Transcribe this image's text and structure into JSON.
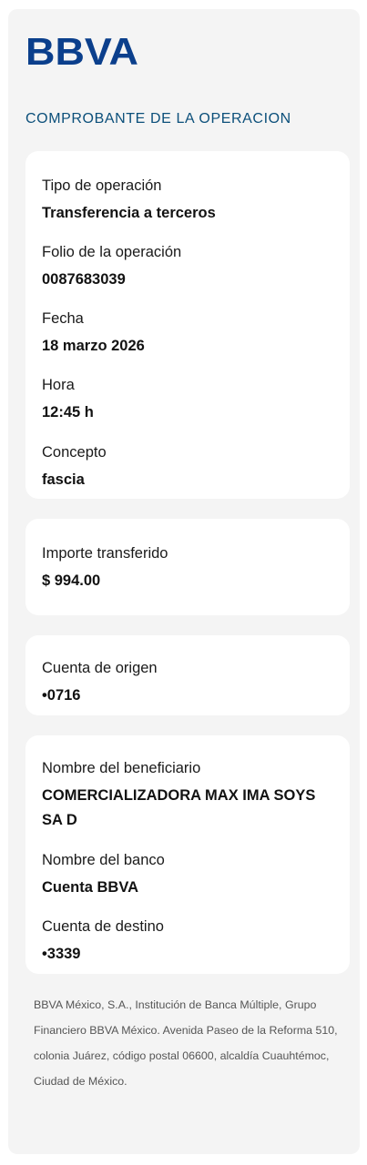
{
  "brand": {
    "logo_text": "BBVA",
    "color": "#0b3f8c"
  },
  "heading": "COMPROBANTE DE LA OPERACION",
  "colors": {
    "heading": "#0b4f7a",
    "card_background": "#ffffff",
    "page_background": "#f4f4f4"
  },
  "operation_card": {
    "tipo_label": "Tipo de operación",
    "tipo_value": "Transferencia a terceros",
    "folio_label": "Folio de la operación",
    "folio_value": "0087683039",
    "fecha_label": "Fecha",
    "fecha_value": "18 marzo 2026",
    "hora_label": "Hora",
    "hora_value": "12:45 h",
    "concepto_label": "Concepto",
    "concepto_value": "fascia"
  },
  "amount_card": {
    "label": "Importe transferido",
    "value": "$ 994.00"
  },
  "origin_card": {
    "label": "Cuenta de origen",
    "value": "•0716"
  },
  "beneficiary_card": {
    "nombre_label": "Nombre del beneficiario",
    "nombre_value": "COMERCIALIZADORA MAX IMA SOYS SA D",
    "banco_label": "Nombre del banco",
    "banco_value": "Cuenta BBVA",
    "destino_label": "Cuenta de destino",
    "destino_value": "•3339"
  },
  "footer_text": "BBVA México, S.A., Institución de Banca Múltiple, Grupo Financiero BBVA México. Avenida Paseo de la Reforma 510, colonia Juárez, código postal 06600, alcaldía Cuauhtémoc, Ciudad de México."
}
